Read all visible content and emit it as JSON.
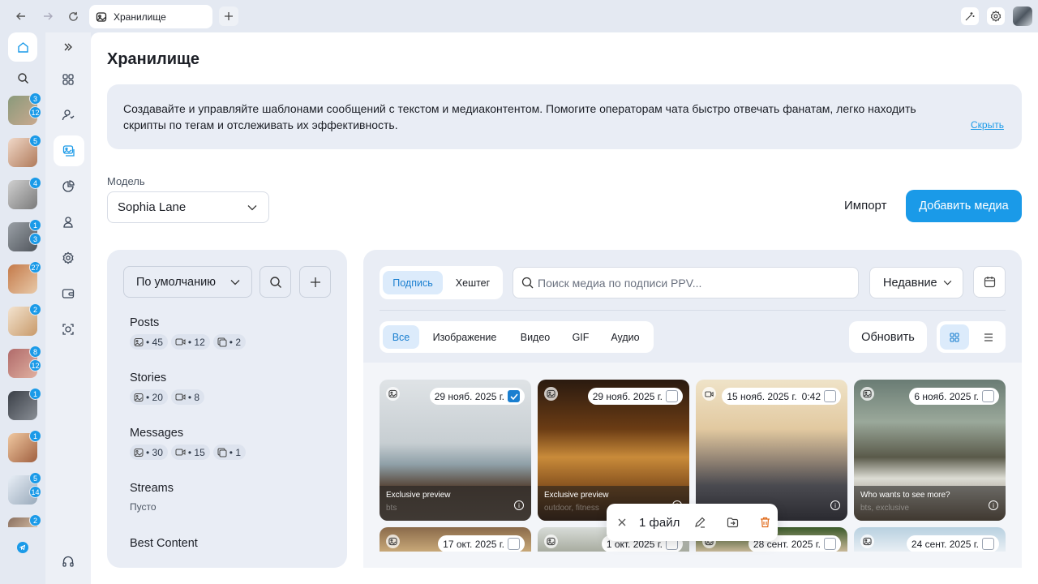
{
  "browser": {
    "tab_title": "Хранилище"
  },
  "rail": {
    "chats": [
      {
        "badge_top": "3",
        "badge_bottom": "12"
      },
      {
        "badge_top": "5",
        "badge_bottom": ""
      },
      {
        "badge_top": "4",
        "badge_bottom": ""
      },
      {
        "badge_top": "1",
        "badge_bottom": "3"
      },
      {
        "badge_top": "27",
        "badge_bottom": ""
      },
      {
        "badge_top": "2",
        "badge_bottom": ""
      },
      {
        "badge_top": "8",
        "badge_bottom": "12"
      },
      {
        "badge_top": "1",
        "badge_bottom": ""
      },
      {
        "badge_top": "1",
        "badge_bottom": ""
      },
      {
        "badge_top": "5",
        "badge_bottom": "14"
      },
      {
        "badge_top": "2",
        "badge_bottom": ""
      }
    ]
  },
  "page": {
    "title": "Хранилище",
    "info_text": "Создавайте и управляйте шаблонами сообщений с текстом и медиаконтентом. Помогите операторам чата быстро отвечать фанатам, легко находить скрипты по тегам и отслеживать их эффективность.",
    "hide_link": "Скрыть",
    "model_label": "Модель",
    "model_value": "Sophia Lane",
    "import_label": "Импорт",
    "add_media_label": "Добавить медиа"
  },
  "folders": {
    "sort_value": "По умолчанию",
    "items": [
      {
        "name": "Posts",
        "chips": [
          "• 45",
          "• 12",
          "• 2"
        ]
      },
      {
        "name": "Stories",
        "chips": [
          "• 20",
          "• 8"
        ]
      },
      {
        "name": "Messages",
        "chips": [
          "• 30",
          "• 15",
          "• 1"
        ]
      },
      {
        "name": "Streams",
        "empty": "Пусто"
      },
      {
        "name": "Best Content"
      }
    ]
  },
  "media": {
    "search_mode_tabs": [
      "Подпись",
      "Хештег"
    ],
    "search_placeholder": "Поиск медиа по подписи PPV...",
    "sort_value": "Недавние",
    "type_tabs": [
      "Все",
      "Изображение",
      "Видео",
      "GIF",
      "Аудио"
    ],
    "refresh_label": "Обновить",
    "cards": [
      {
        "date": "29 нояб. 2025 г.",
        "duration": "",
        "caption": "Exclusive preview",
        "tags": "bts",
        "checked": true,
        "type_icon": "image-icon"
      },
      {
        "date": "29 нояб. 2025 г.",
        "duration": "",
        "caption": "Exclusive preview",
        "tags": "outdoor, fitness",
        "checked": false,
        "type_icon": "image-icon"
      },
      {
        "date": "15 нояб. 2025 г.",
        "duration": "0:42",
        "caption": "",
        "tags": "",
        "checked": false,
        "type_icon": "video-icon"
      },
      {
        "date": "6 нояб. 2025 г.",
        "duration": "",
        "caption": "Who wants to see more?",
        "tags": "bts, exclusive",
        "checked": false,
        "type_icon": "image-icon"
      },
      {
        "date": "17 окт. 2025 г.",
        "duration": "",
        "checked": false,
        "type_icon": "image-icon"
      },
      {
        "date": "1 окт. 2025 г.",
        "duration": "",
        "checked": false,
        "type_icon": "image-icon"
      },
      {
        "date": "28 сент. 2025 г.",
        "duration": "",
        "checked": false,
        "type_icon": "image-icon"
      },
      {
        "date": "24 сент. 2025 г.",
        "duration": "",
        "checked": false,
        "type_icon": "image-icon"
      }
    ]
  },
  "selection": {
    "count_label": "1 файл"
  },
  "colors": {
    "accent": "#1a9ae8",
    "panel_bg": "#e9edf5"
  }
}
